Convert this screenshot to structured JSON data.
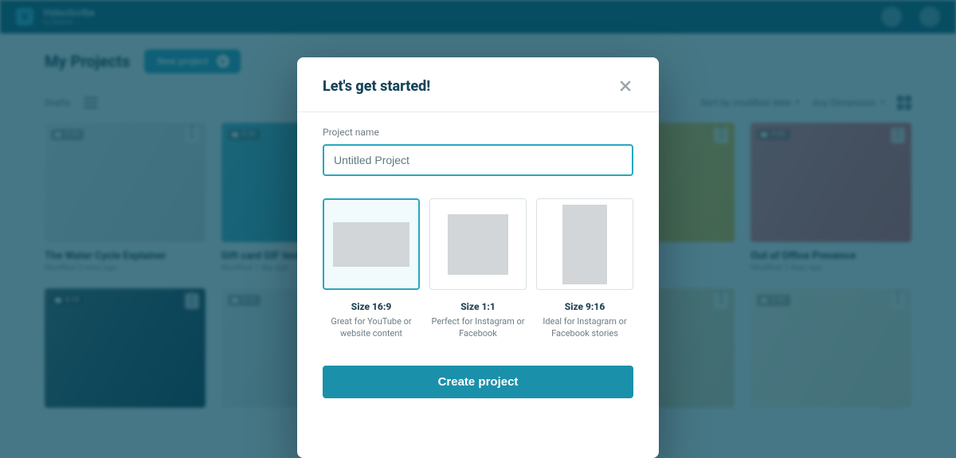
{
  "app": {
    "name": "VideoScribe",
    "sub": "by Sparkol"
  },
  "header": {
    "page_title": "My Projects",
    "new_project_label": "New project"
  },
  "toolbar": {
    "status_label": "Drafts",
    "sort_label": "Sort by modified date",
    "sort2_label": "Any Dimension"
  },
  "cards": [
    {
      "title": "The Water Cycle Explainer",
      "sub": "Modified 3 mins ago",
      "badge": "0:35",
      "thumb": "light"
    },
    {
      "title": "Gift card GIF test",
      "sub": "Modified 1 day ago",
      "badge": "0:20",
      "thumb": "teal"
    },
    {
      "title": "",
      "sub": "",
      "badge": "",
      "thumb": "lightblue"
    },
    {
      "title": "",
      "sub": "",
      "badge": "",
      "thumb": "yellow"
    },
    {
      "title": "Out of Office Presence",
      "sub": "Modified 7 days ago",
      "badge": "0:45",
      "thumb": "gift"
    },
    {
      "title": "",
      "sub": "",
      "badge": "0:10",
      "thumb": "dark"
    },
    {
      "title": "",
      "sub": "",
      "badge": "0:12",
      "thumb": "light"
    },
    {
      "title": "",
      "sub": "",
      "badge": "",
      "thumb": "lightblue"
    },
    {
      "title": "",
      "sub": "",
      "badge": "",
      "thumb": "beige"
    },
    {
      "title": "",
      "sub": "",
      "badge": "0:30",
      "thumb": "ecru"
    }
  ],
  "modal": {
    "title": "Let's get started!",
    "name_label": "Project name",
    "name_value": "Untitled Project",
    "name_placeholder": "Untitled Project",
    "create_label": "Create project",
    "aspects": [
      {
        "label": "Size 16:9",
        "desc": "Great for YouTube or website content",
        "kind": "wide",
        "selected": true
      },
      {
        "label": "Size 1:1",
        "desc": "Perfect for Instagram or Facebook",
        "kind": "square",
        "selected": false
      },
      {
        "label": "Size 9:16",
        "desc": "Ideal for Instagram or Facebook stories",
        "kind": "tall",
        "selected": false
      }
    ]
  }
}
